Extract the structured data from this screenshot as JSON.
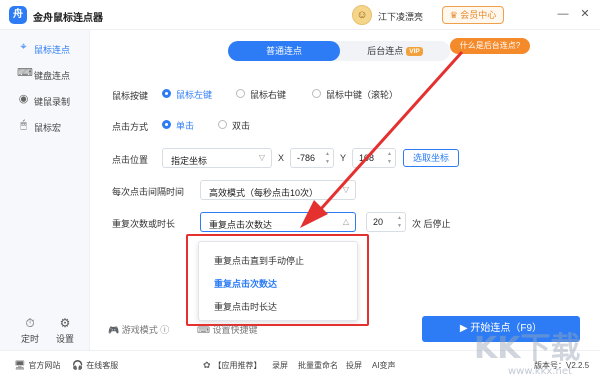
{
  "app": {
    "title": "金舟鼠标连点器",
    "logo_text": "舟"
  },
  "header": {
    "username": "江下凌漂亮",
    "member_label": "会员中心",
    "window_buttons": [
      "minimize-icon",
      "close-icon"
    ]
  },
  "sidebar": {
    "items": [
      {
        "label": "鼠标连点",
        "icon": "mouse-click-icon",
        "active": true
      },
      {
        "label": "键盘连点",
        "icon": "keyboard-icon",
        "active": false
      },
      {
        "label": "键鼠录制",
        "icon": "record-icon",
        "active": false
      },
      {
        "label": "鼠标宏",
        "icon": "mouse-icon",
        "active": false
      }
    ],
    "bottom": [
      {
        "label": "定时",
        "icon": "clock-icon"
      },
      {
        "label": "设置",
        "icon": "settings-icon"
      }
    ]
  },
  "tabs": {
    "normal": "普通连点",
    "background": "后台连点",
    "vip_badge": "VIP",
    "tip": "什么是后台连点?"
  },
  "form": {
    "mouse_button": {
      "label": "鼠标按键",
      "options": [
        "鼠标左键",
        "鼠标右键",
        "鼠标中键（滚轮）"
      ],
      "selected": 0
    },
    "click_mode": {
      "label": "点击方式",
      "options": [
        "单击",
        "双击"
      ],
      "selected": 0
    },
    "click_position": {
      "label": "点击位置",
      "mode": "指定坐标",
      "x_label": "X",
      "x_value": "-786",
      "y_label": "Y",
      "y_value": "108",
      "pick_label": "选取坐标"
    },
    "interval": {
      "label": "每次点击间隔时间",
      "value": "高效模式（每秒点击10次）"
    },
    "repeat": {
      "label": "重复次数或时长",
      "value": "重复点击次数达",
      "count": "20",
      "suffix": "次 后停止"
    }
  },
  "dropdown": {
    "items": [
      "重复点击直到手动停止",
      "重复点击次数达",
      "重复点击时长达"
    ],
    "selected": 1
  },
  "bottom_bar": {
    "game_mode": "游戏模式",
    "shortcut": "设置快捷键",
    "start": "开始连点（F9）"
  },
  "footer": {
    "website": "官方网站",
    "support": "在线客服",
    "recommend": "【应用推荐】",
    "apps": [
      "录屏",
      "批量重命名",
      "投屏",
      "AI变声"
    ],
    "version": "版本号：V2.2.5"
  },
  "colors": {
    "accent": "#2d7cf6",
    "highlight": "#e53030",
    "tip": "#f58a2b"
  }
}
